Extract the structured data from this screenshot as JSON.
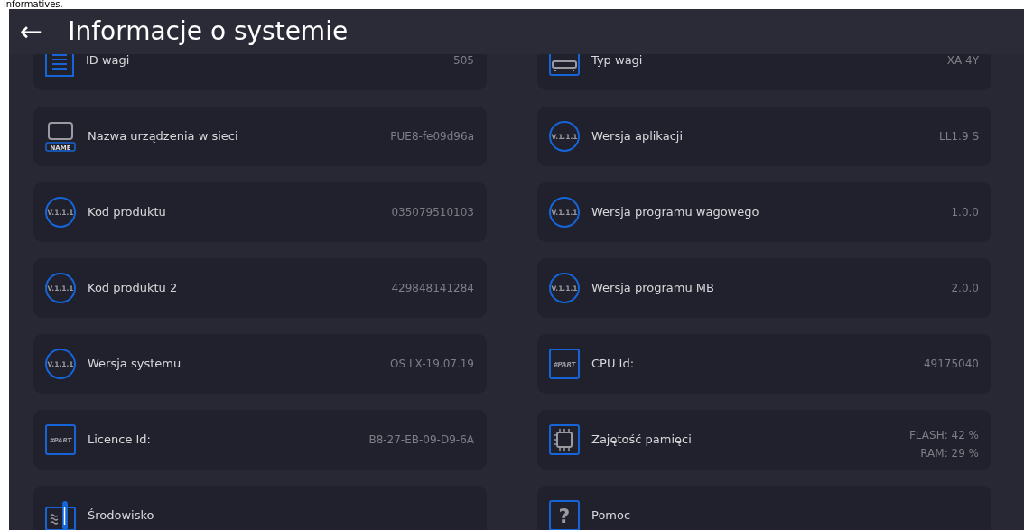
{
  "top_strip_text": "informatives.",
  "header": {
    "back_icon": "←",
    "title": "Informacje o systemie"
  },
  "items": [
    {
      "label": "ID wagi",
      "values": [
        "505"
      ],
      "icon": {
        "kind": "document"
      }
    },
    {
      "label": "Typ wagi",
      "values": [
        "XA 4Y"
      ],
      "icon": {
        "kind": "scale"
      }
    },
    {
      "label": "Nazwa urządzenia w sieci",
      "values": [
        "PUE8-fe09d96a"
      ],
      "icon": {
        "kind": "name-tag",
        "label": "NAME"
      }
    },
    {
      "label": "Wersja aplikacji",
      "values": [
        "LL1.9 S"
      ],
      "icon": {
        "kind": "version",
        "label": "V.1.1.1"
      }
    },
    {
      "label": "Kod produktu",
      "values": [
        "035079510103"
      ],
      "icon": {
        "kind": "version",
        "label": "V.1.1.1"
      }
    },
    {
      "label": "Wersja programu wagowego",
      "values": [
        "1.0.0"
      ],
      "icon": {
        "kind": "version",
        "label": "V.1.1.1"
      }
    },
    {
      "label": "Kod produktu 2",
      "values": [
        "429848141284"
      ],
      "icon": {
        "kind": "version",
        "label": "V.1.1.1"
      }
    },
    {
      "label": "Wersja programu MB",
      "values": [
        "2.0.0"
      ],
      "icon": {
        "kind": "version",
        "label": "V.1.1.1"
      }
    },
    {
      "label": "Wersja systemu",
      "values": [
        "OS LX-19.07.19"
      ],
      "icon": {
        "kind": "version",
        "label": "V.1.1.1"
      }
    },
    {
      "label": "CPU Id:",
      "values": [
        "49175040"
      ],
      "icon": {
        "kind": "part",
        "label": "#PART"
      }
    },
    {
      "label": "Licence Id:",
      "values": [
        "B8-27-EB-09-D9-6A"
      ],
      "icon": {
        "kind": "part",
        "label": "#PART"
      }
    },
    {
      "label": "Zajętość pamięci",
      "values": [
        "FLASH: 42 %",
        "RAM: 29 %"
      ],
      "icon": {
        "kind": "chip"
      }
    },
    {
      "label": "Środowisko",
      "icon": {
        "kind": "thermometer"
      }
    },
    {
      "label": "Pomoc",
      "icon": {
        "kind": "question",
        "label": "?"
      }
    }
  ]
}
